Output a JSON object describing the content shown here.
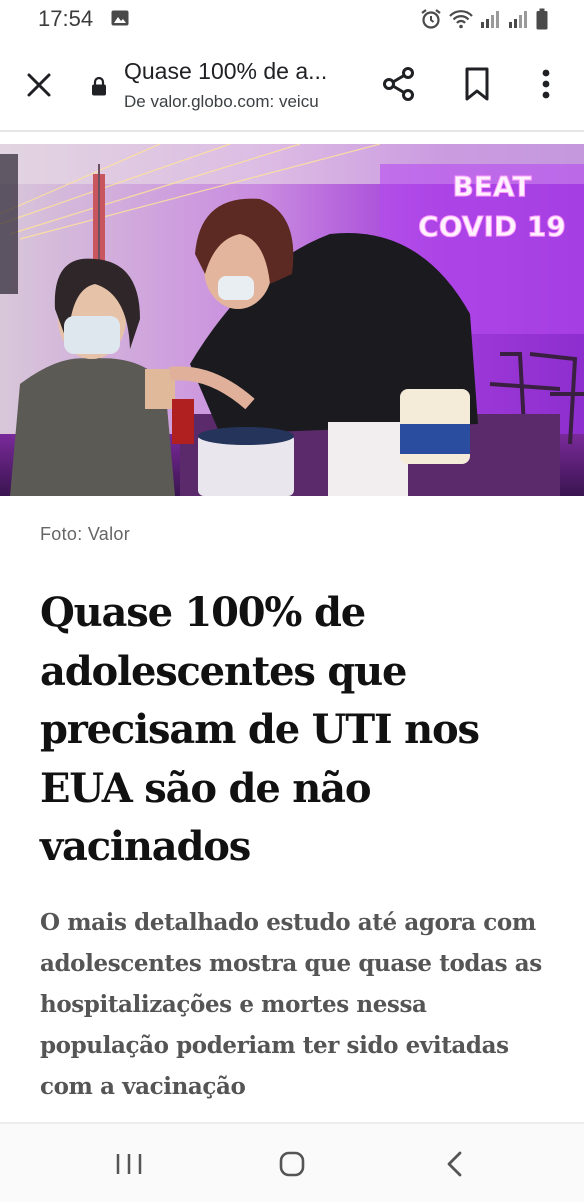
{
  "status_bar": {
    "time": "17:54",
    "icons": [
      "image-icon",
      "alarm-icon",
      "wifi-icon",
      "signal-icon",
      "signal-icon",
      "battery-icon"
    ]
  },
  "browser": {
    "page_title": "Quase 100% de a...",
    "url": "De valor.globo.com: veicu",
    "icons": [
      "close-icon",
      "lock-icon",
      "share-icon",
      "bookmark-icon",
      "more-icon"
    ]
  },
  "article": {
    "photo_neon_line1": "BEAT",
    "photo_neon_line2": "COVID 19",
    "photo_credit": "Foto: Valor",
    "headline": "Quase 100% de adolescentes que precisam de UTI nos EUA são de não vacinados",
    "subheadline": "O mais detalhado estudo até agora com adolescentes mostra que quase todas as hospitalizações e mortes nessa população poderiam ter sido evitadas com a vacinação"
  },
  "nav": {
    "icons": [
      "recent-apps-icon",
      "home-icon",
      "back-icon"
    ]
  }
}
